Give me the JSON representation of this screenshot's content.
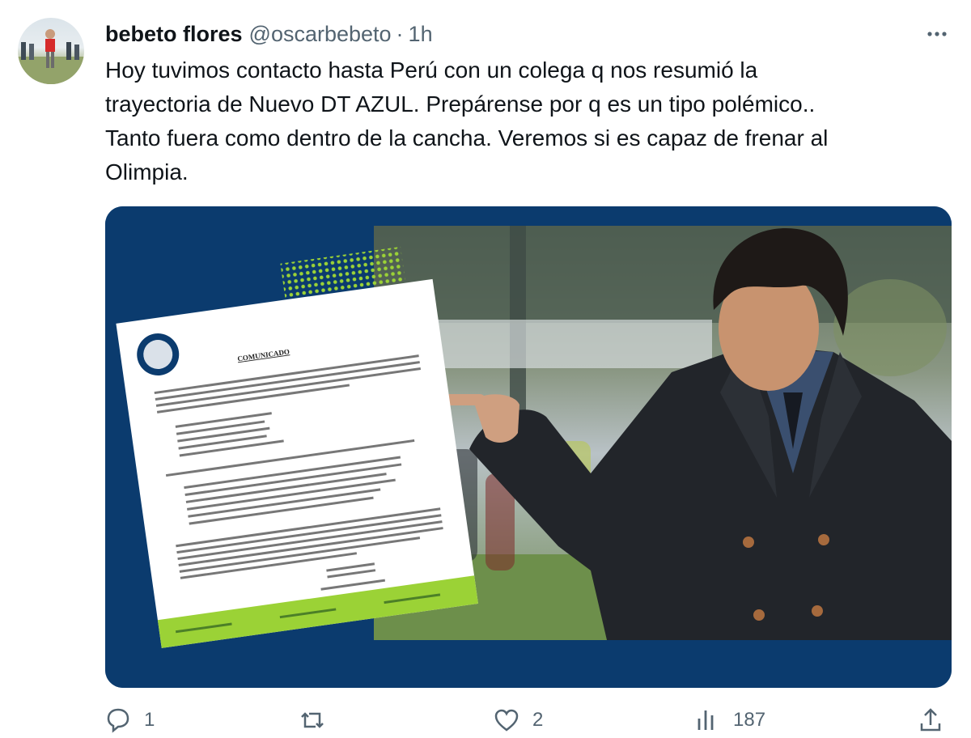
{
  "tweet": {
    "author_name": "bebeto flores",
    "author_handle": "@oscarbebeto",
    "separator": "·",
    "time": "1h",
    "text": "Hoy tuvimos contacto hasta Perú con un colega q nos resumió la\ntrayectoria de Nuevo DT AZUL. Prepárense por q es un tipo polémico..\nTanto fuera como dentro de la cancha. Veremos si es capaz de frenar al\nOlimpia.",
    "more_icon": "more-horizontal-icon"
  },
  "media": {
    "document_heading": "COMUNICADO",
    "colors": {
      "frame": "#0b3b6e",
      "accent": "#9bd236"
    }
  },
  "actions": [
    {
      "icon": "reply-icon",
      "count": "1"
    },
    {
      "icon": "retweet-icon",
      "count": ""
    },
    {
      "icon": "like-icon",
      "count": "2"
    },
    {
      "icon": "views-icon",
      "count": "187"
    },
    {
      "icon": "share-icon",
      "count": ""
    }
  ]
}
